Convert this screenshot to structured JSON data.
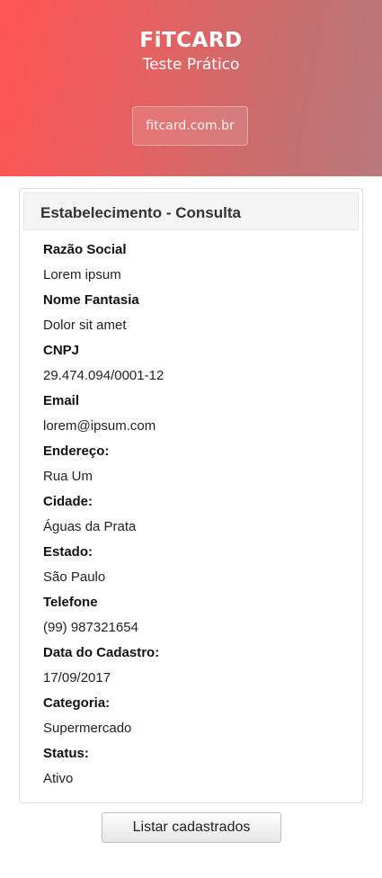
{
  "header": {
    "brand": "FiTCARD",
    "subtitle": "Teste Prático",
    "site_link": "fitcard.com.br"
  },
  "panel": {
    "title": "Estabelecimento - Consulta",
    "fields": [
      {
        "label": "Razão Social",
        "value": "Lorem ipsum"
      },
      {
        "label": "Nome Fantasia",
        "value": "Dolor sit amet"
      },
      {
        "label": "CNPJ",
        "value": "29.474.094/0001-12"
      },
      {
        "label": "Email",
        "value": "lorem@ipsum.com"
      },
      {
        "label": "Endereço:",
        "value": "Rua Um"
      },
      {
        "label": "Cidade:",
        "value": "Águas da Prata"
      },
      {
        "label": "Estado:",
        "value": "São Paulo"
      },
      {
        "label": "Telefone",
        "value": "(99) 987321654"
      },
      {
        "label": "Data do Cadastro:",
        "value": "17/09/2017"
      },
      {
        "label": "Categoria:",
        "value": "Supermercado"
      },
      {
        "label": "Status:",
        "value": "Ativo"
      }
    ]
  },
  "actions": {
    "list_button": "Listar cadastrados"
  },
  "colors": {
    "header_gradient_start": "#ff5454",
    "header_gradient_end": "#b8797b"
  }
}
